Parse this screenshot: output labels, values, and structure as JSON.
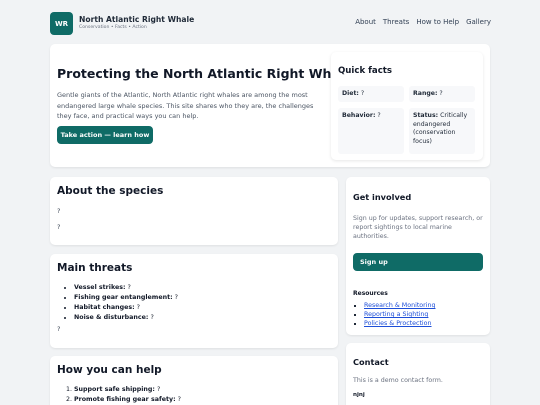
{
  "header": {
    "logo_text": "WR",
    "title": "North Atlantic Right Whale",
    "tagline": "Conservation • Facts • Action",
    "nav": [
      "About",
      "Threats",
      "How to Help",
      "Gallery"
    ]
  },
  "hero": {
    "title": "Protecting the North Atlantic Right Whale",
    "description": "Gentle giants of the Atlantic, North Atlantic right whales are among the most endangered large whale species. This site shares who they are, the challenges they face, and practical ways you can help.",
    "cta": "Take action — learn how"
  },
  "quick_facts": {
    "title": "Quick facts",
    "items": [
      {
        "label": "Diet:",
        "value": "?"
      },
      {
        "label": "Range:",
        "value": "?"
      },
      {
        "label": "Behavior:",
        "value": "?"
      },
      {
        "label": "Status:",
        "value": "Critically endangered (conservation focus)"
      }
    ]
  },
  "about": {
    "title": "About the species",
    "lines": [
      "?",
      "?"
    ]
  },
  "threats": {
    "title": "Main threats",
    "items": [
      {
        "label": "Vessel strikes:",
        "value": "?"
      },
      {
        "label": "Fishing gear entanglement:",
        "value": "?"
      },
      {
        "label": "Habitat changes:",
        "value": "?"
      },
      {
        "label": "Noise & disturbance:",
        "value": "?"
      }
    ],
    "footer": "?"
  },
  "help": {
    "title": "How you can help",
    "items": [
      {
        "label": "Support safe shipping:",
        "value": "?"
      },
      {
        "label": "Promote fishing gear safety:",
        "value": "?"
      }
    ]
  },
  "get_involved": {
    "title": "Get involved",
    "text": "Sign up for updates, support research, or report sightings to local marine authorities.",
    "button": "Sign up",
    "resources_label": "Resources",
    "resources": [
      "Research & Monitoring",
      "Reporting a Sighting",
      "Policies & Proctection"
    ]
  },
  "contact": {
    "title": "Contact",
    "text": "This is a demo contact form.",
    "field_label": "njnj"
  },
  "colors": {
    "accent": "#0f6b66",
    "link": "#1d4ed8",
    "background": "#f1f3f5"
  }
}
